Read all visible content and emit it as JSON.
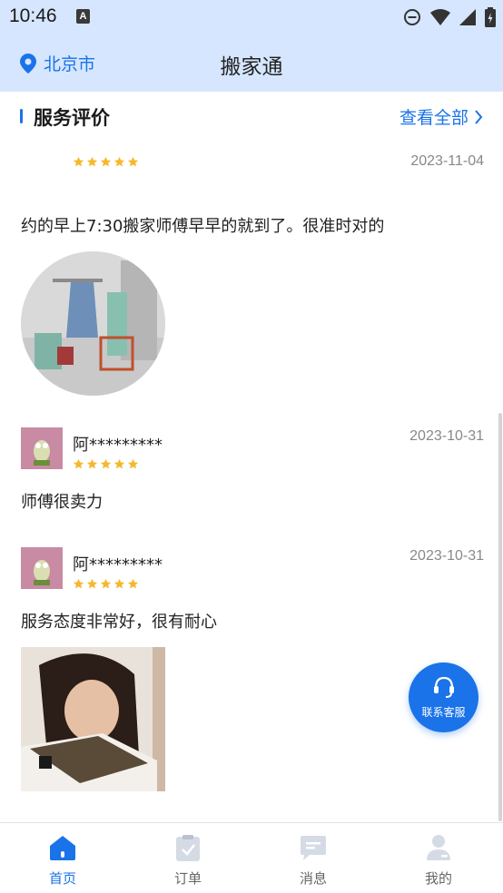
{
  "status_bar": {
    "time": "10:46",
    "notification_icon": "a-icon"
  },
  "header": {
    "location": "北京市",
    "title": "搬家通"
  },
  "section": {
    "title": "服务评价",
    "more": "查看全部"
  },
  "reviews": [
    {
      "user": "",
      "date": "2023-11-04",
      "rating": 5,
      "text": "约的早上7:30搬家师傅早早的就到了。很准时对的",
      "has_photo": true
    },
    {
      "user": "阿*********",
      "date": "2023-10-31",
      "rating": 5,
      "text": "师傅很卖力",
      "has_photo": false
    },
    {
      "user": "阿*********",
      "date": "2023-10-31",
      "rating": 5,
      "text": "服务态度非常好，很有耐心",
      "has_photo": true
    }
  ],
  "fab": {
    "label": "联系客服"
  },
  "bottom_nav": [
    {
      "label": "首页",
      "icon": "home-icon",
      "active": true
    },
    {
      "label": "订单",
      "icon": "order-icon",
      "active": false
    },
    {
      "label": "消息",
      "icon": "message-icon",
      "active": false
    },
    {
      "label": "我的",
      "icon": "profile-icon",
      "active": false
    }
  ],
  "colors": {
    "accent": "#1a73e8",
    "header_bg": "#d6e6ff",
    "star": "#f5b82e"
  }
}
